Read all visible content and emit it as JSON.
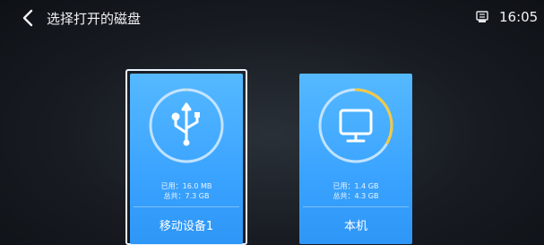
{
  "header": {
    "title": "选择打开的磁盘",
    "time": "16:05"
  },
  "disks": [
    {
      "name": "移动设备1",
      "used": "已用：16.0 MB",
      "total": "总共：7.3 GB",
      "used_fraction": 0.002,
      "icon": "usb-icon",
      "selected": true
    },
    {
      "name": "本机",
      "used": "已用：1.4 GB",
      "total": "总共：4.3 GB",
      "used_fraction": 0.33,
      "icon": "monitor-icon",
      "selected": false
    }
  ],
  "colors": {
    "card": "#3aa3ff",
    "usage_arc": "#f5c842",
    "ring": "#cfe9ff"
  }
}
